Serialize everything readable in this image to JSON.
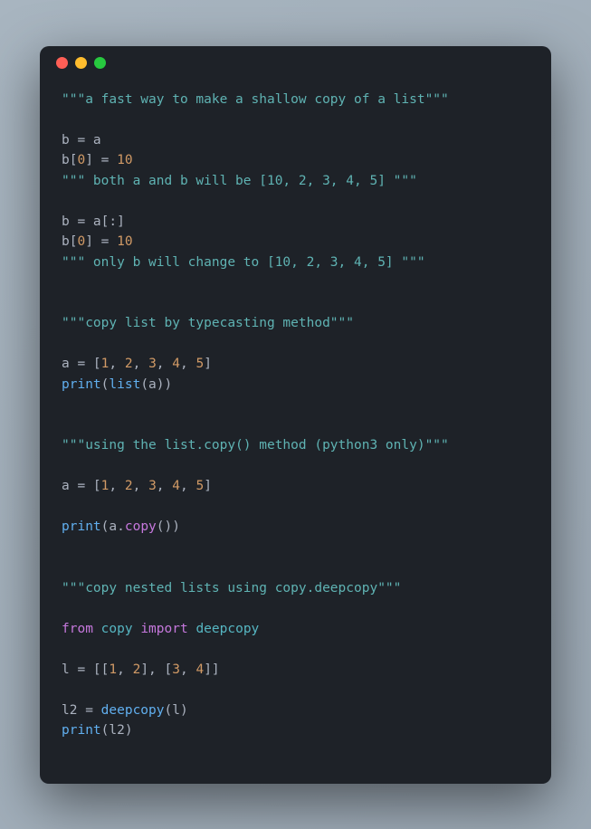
{
  "code_tokens": {
    "doc1": "\"\"\"a fast way to make a shallow copy of a list\"\"\"",
    "l2_a": "b = a",
    "l3_a": "b[",
    "l3_n0": "0",
    "l3_b": "] = ",
    "l3_n10": "10",
    "doc2": "\"\"\" both a and b will be [10, 2, 3, 4, 5] \"\"\"",
    "l5_a": "b = a[:]",
    "l6_a": "b[",
    "l6_n0": "0",
    "l6_b": "] = ",
    "l6_n10": "10",
    "doc3": "\"\"\" only b will change to [10, 2, 3, 4, 5] \"\"\"",
    "doc4": "\"\"\"copy list by typecasting method\"\"\"",
    "l8_a": "a = [",
    "n1": "1",
    "c": ", ",
    "n2": "2",
    "n3": "3",
    "n4": "4",
    "n5": "5",
    "rbr": "]",
    "print": "print",
    "list": "list",
    "lp": "(",
    "rp": ")",
    "a_var": "a",
    "doc5": "\"\"\"using the list.copy() method (python3 only)\"\"\"",
    "l10_a": "a = [",
    "dot": ".",
    "copy_m": "copy",
    "empty_call": "()",
    "doc6": "\"\"\"copy nested lists using copy.deepcopy\"\"\"",
    "from": "from",
    "sp": " ",
    "copy_mod": "copy",
    "import": "import",
    "deepcopy": "deepcopy",
    "l_eq": "l = [[",
    "inner_sep": "], [",
    "rr": "]]",
    "l2_eq": "l2 = deepcopy(l)",
    "l2v": "l2",
    "l2_assign_a": "l2 = ",
    "deepcopy_call": "deepcopy",
    "lvar": "l"
  }
}
